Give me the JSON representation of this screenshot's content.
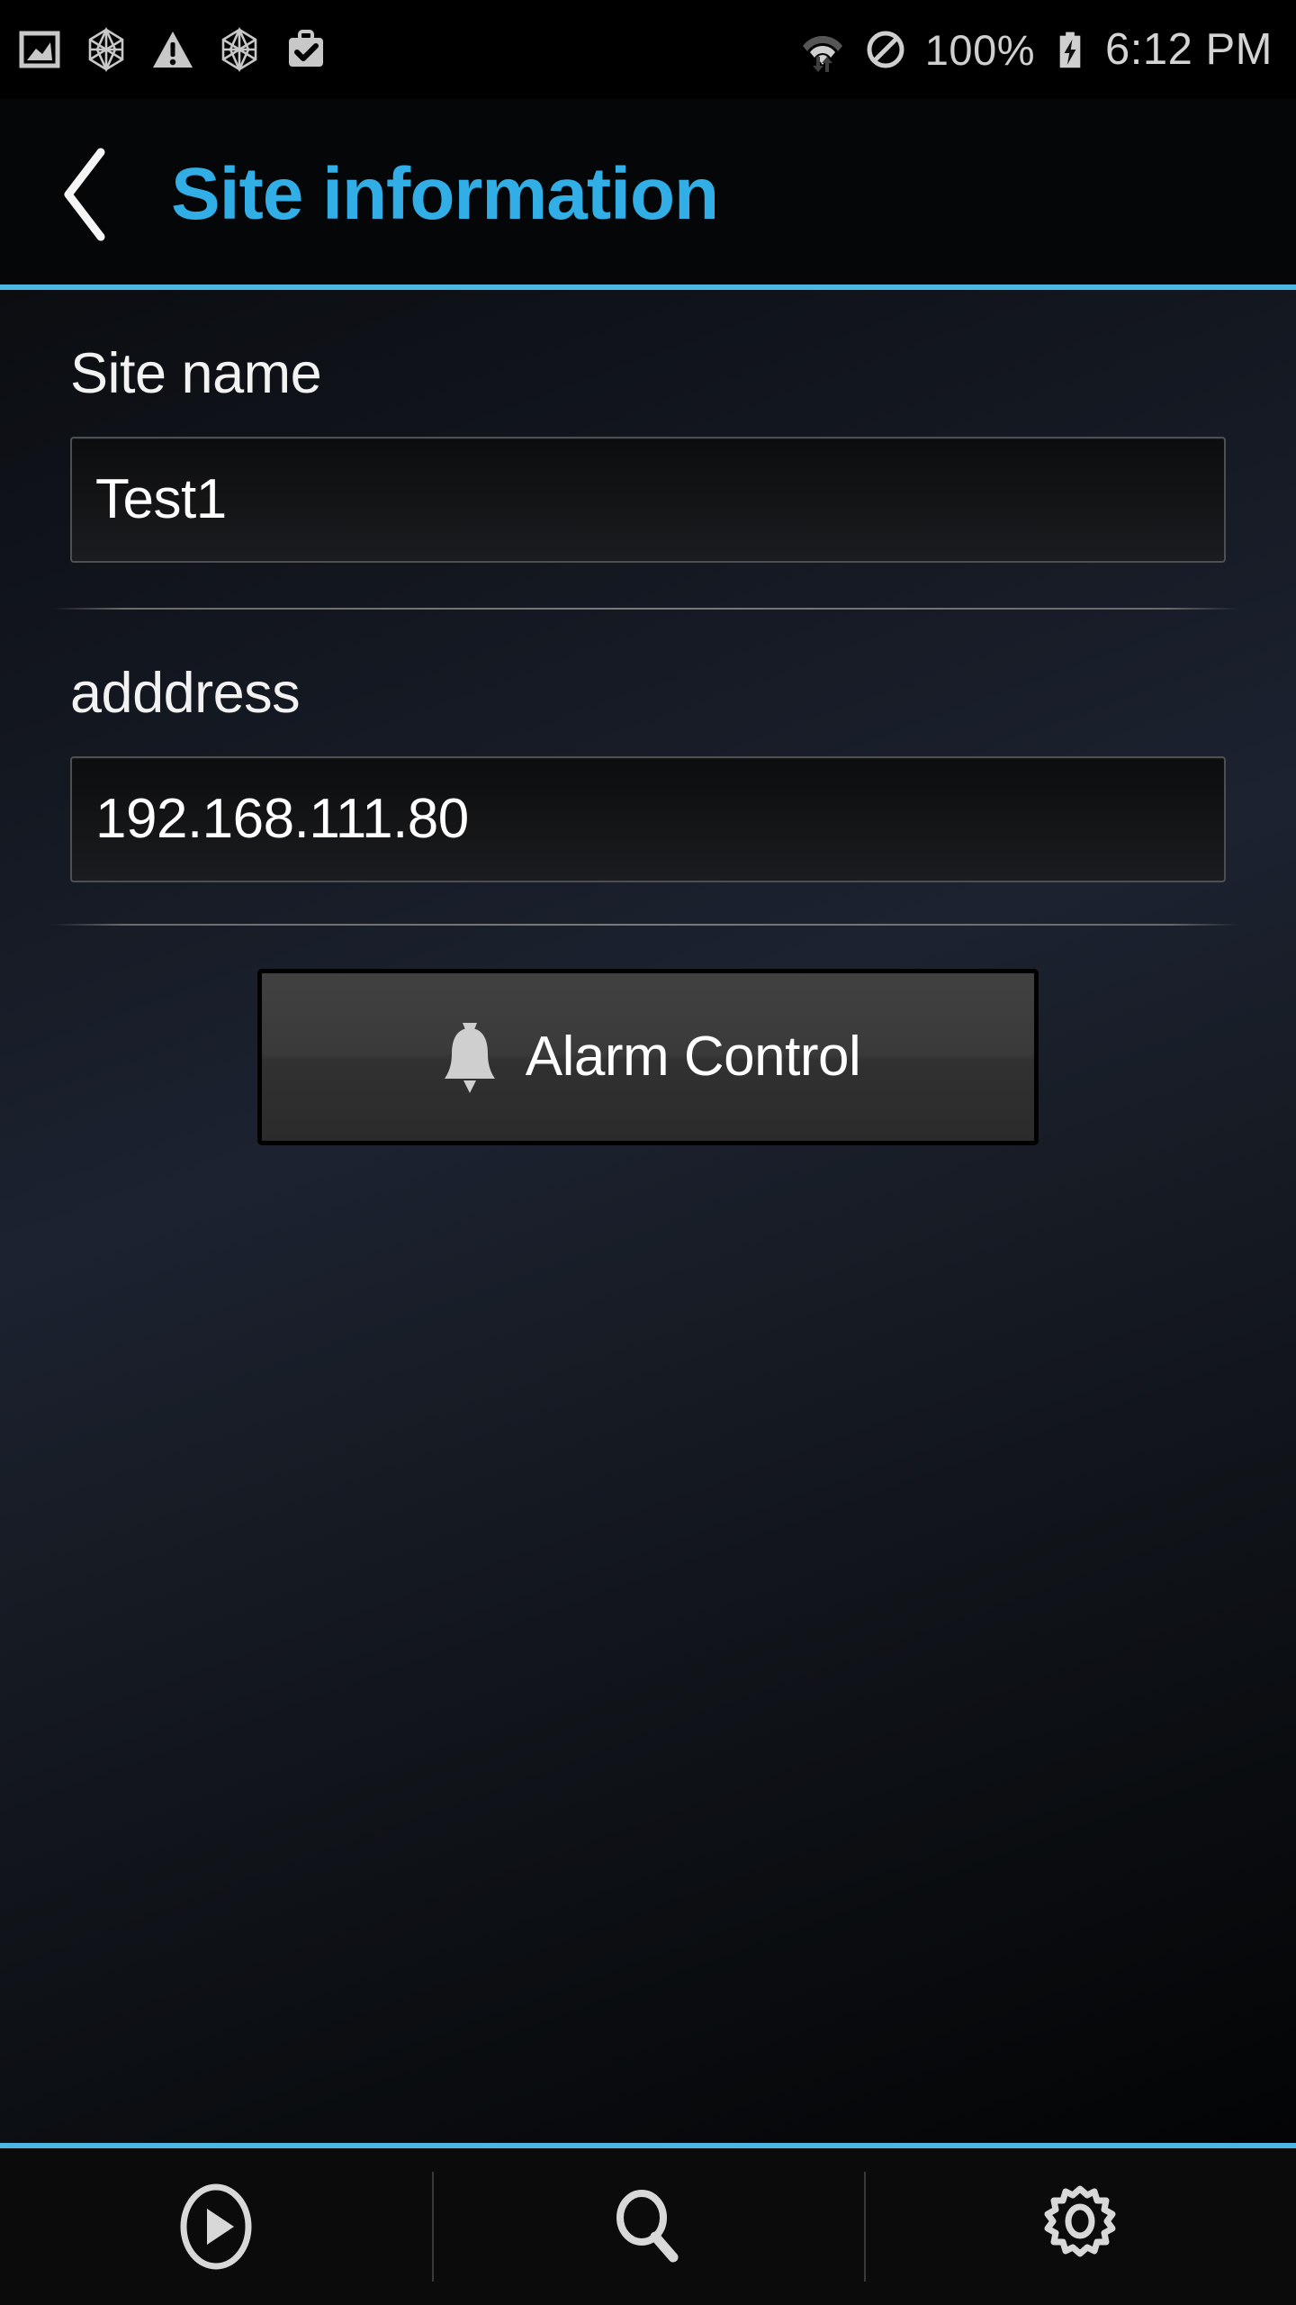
{
  "status_bar": {
    "left_icons": [
      {
        "name": "image-icon",
        "label": "Screenshot"
      },
      {
        "name": "hex-mesh-icon",
        "label": "Network mesh"
      },
      {
        "name": "warning-icon",
        "label": "Warning"
      },
      {
        "name": "hex-mesh-icon-2",
        "label": "Network mesh"
      },
      {
        "name": "briefcase-check-icon",
        "label": "Work profile"
      }
    ],
    "wifi_icon": "wifi-data-icon",
    "mute_icon": "do-not-disturb-icon",
    "battery_percent": "100%",
    "battery_icon": "battery-charging-icon",
    "time": "6:12 PM"
  },
  "title_bar": {
    "back_icon": "back-chevron-icon",
    "title": "Site information",
    "accent_color": "#4cb7e2",
    "title_color": "#31aee6"
  },
  "form": {
    "fields": [
      {
        "label": "Site name",
        "value": "Test1",
        "placeholder": "Site name"
      },
      {
        "label": "adddress",
        "value": "192.168.111.80",
        "placeholder": "adddress"
      }
    ],
    "alarm_button": {
      "label": "Alarm Control",
      "icon": "bell-icon"
    }
  },
  "bottom_nav": {
    "items": [
      {
        "name": "play-button",
        "icon": "play-circle-icon",
        "label": "Play"
      },
      {
        "name": "search-button",
        "icon": "search-icon",
        "label": "Search"
      },
      {
        "name": "settings-button",
        "icon": "gear-icon",
        "label": "Settings"
      }
    ]
  }
}
